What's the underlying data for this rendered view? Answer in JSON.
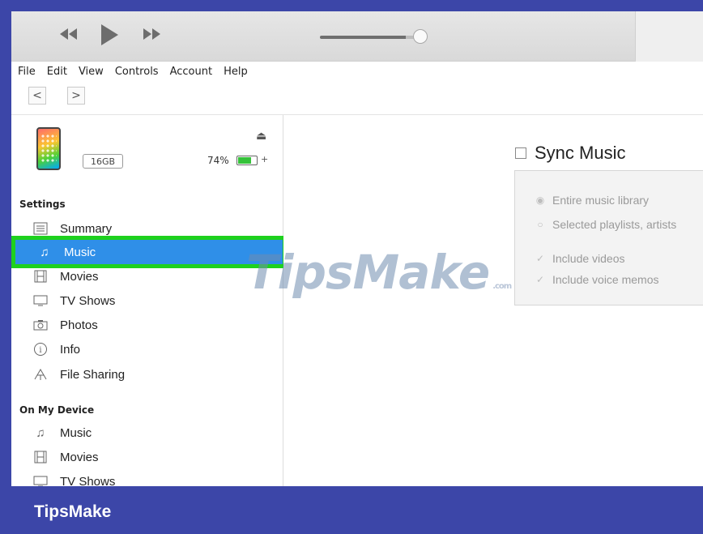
{
  "menu": [
    "File",
    "Edit",
    "View",
    "Controls",
    "Account",
    "Help"
  ],
  "nav": {
    "back": "<",
    "forward": ">"
  },
  "device": {
    "capacity": "16GB",
    "battery_percent": "74%",
    "battery_level": 0.74,
    "eject_icon": "eject-icon"
  },
  "sidebar": {
    "settings_title": "Settings",
    "settings_items": [
      {
        "label": "Summary",
        "icon": "summary-icon"
      },
      {
        "label": "Music",
        "icon": "music-note-icon",
        "active": true
      },
      {
        "label": "Movies",
        "icon": "film-icon"
      },
      {
        "label": "TV Shows",
        "icon": "tv-icon"
      },
      {
        "label": "Photos",
        "icon": "camera-icon"
      },
      {
        "label": "Info",
        "icon": "info-icon"
      },
      {
        "label": "File Sharing",
        "icon": "file-sharing-icon"
      }
    ],
    "device_title": "On My Device",
    "device_items": [
      {
        "label": "Music",
        "icon": "music-note-icon"
      },
      {
        "label": "Movies",
        "icon": "film-icon"
      },
      {
        "label": "TV Shows",
        "icon": "tv-icon"
      }
    ]
  },
  "main": {
    "sync_label": "Sync Music",
    "options": [
      "Entire music library",
      "Selected playlists, artists",
      "Include videos",
      "Include voice memos"
    ]
  },
  "watermark": {
    "text": "TipsMake",
    "suffix": ".com"
  },
  "footer": {
    "brand": "TipsMake"
  },
  "colors": {
    "selection": "#2f8fe8",
    "highlight_outline": "#1ed11e",
    "brand_bar": "#3c46a8",
    "battery": "#35c23a"
  }
}
